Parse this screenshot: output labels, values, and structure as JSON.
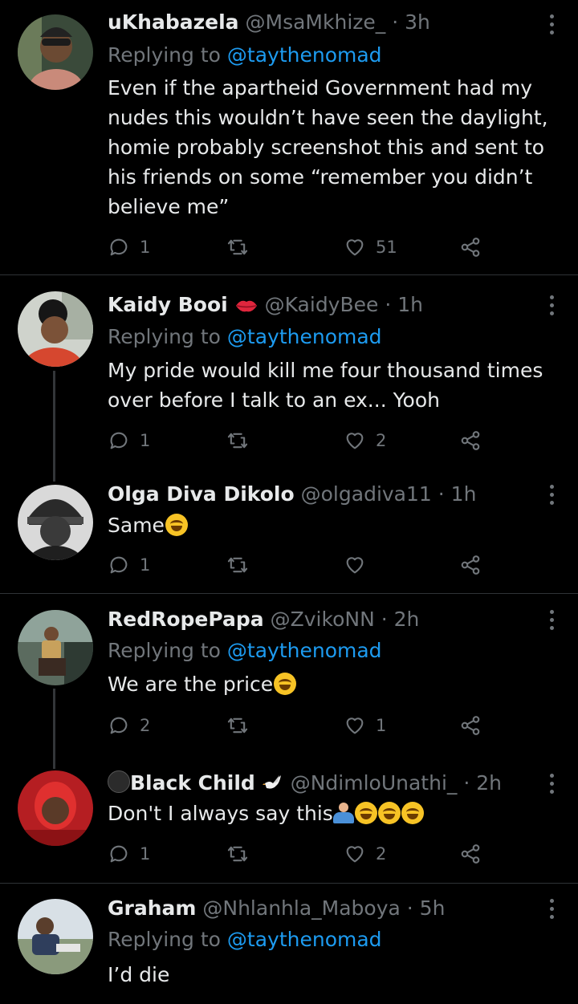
{
  "colors": {
    "background": "#000000",
    "text": "#e7e9ea",
    "muted": "#71767b",
    "link": "#1d9bf0"
  },
  "tweets": [
    {
      "name": "uKhabazela",
      "handle": "@MsaMkhize_",
      "time": "· 3h",
      "replying_prefix": "Replying to",
      "replying_handle": "@taythenomad",
      "text": "Even if the apartheid Government had my nudes this wouldn’t have seen the daylight, homie probably screenshot this and sent to his friends on some “remember you didn’t believe me”",
      "replies": "1",
      "retweets": "",
      "likes": "51"
    },
    {
      "name": "Kaidy Booi",
      "name_emoji": "lips-emoji",
      "handle": "@KaidyBee",
      "time": "· 1h",
      "replying_prefix": "Replying to",
      "replying_handle": "@taythenomad",
      "text": "My pride would kill me four thousand times over before I talk to an ex... Yooh",
      "replies": "1",
      "retweets": "",
      "likes": "2"
    },
    {
      "name": "Olga Diva Dikolo",
      "handle": "@olgadiva11",
      "time": "· 1h",
      "text": "Same",
      "text_emoji": "rofl-emoji",
      "replies": "1",
      "retweets": "",
      "likes": ""
    },
    {
      "name": "RedRopePapa",
      "handle": "@ZvikoNN",
      "time": "· 2h",
      "replying_prefix": "Replying to",
      "replying_handle": "@taythenomad",
      "text": "We are the price",
      "text_emoji": "tears-of-joy-emoji",
      "replies": "2",
      "retweets": "",
      "likes": "1"
    },
    {
      "name": "Black Child",
      "name_prefix_emoji": "black-circle-emoji",
      "name_emoji": "dove-emoji",
      "handle": "@NdimloUnathi_",
      "time": "· 2h",
      "text": "Don't I always say this",
      "text_emoji": "shrug-emoji rofl-emoji rofl-emoji rofl-emoji",
      "replies": "1",
      "retweets": "",
      "likes": "2"
    },
    {
      "name": "Graham",
      "handle": "@Nhlanhla_Maboya",
      "time": "· 5h",
      "replying_prefix": "Replying to",
      "replying_handle": "@taythenomad",
      "text": "I’d die"
    }
  ]
}
